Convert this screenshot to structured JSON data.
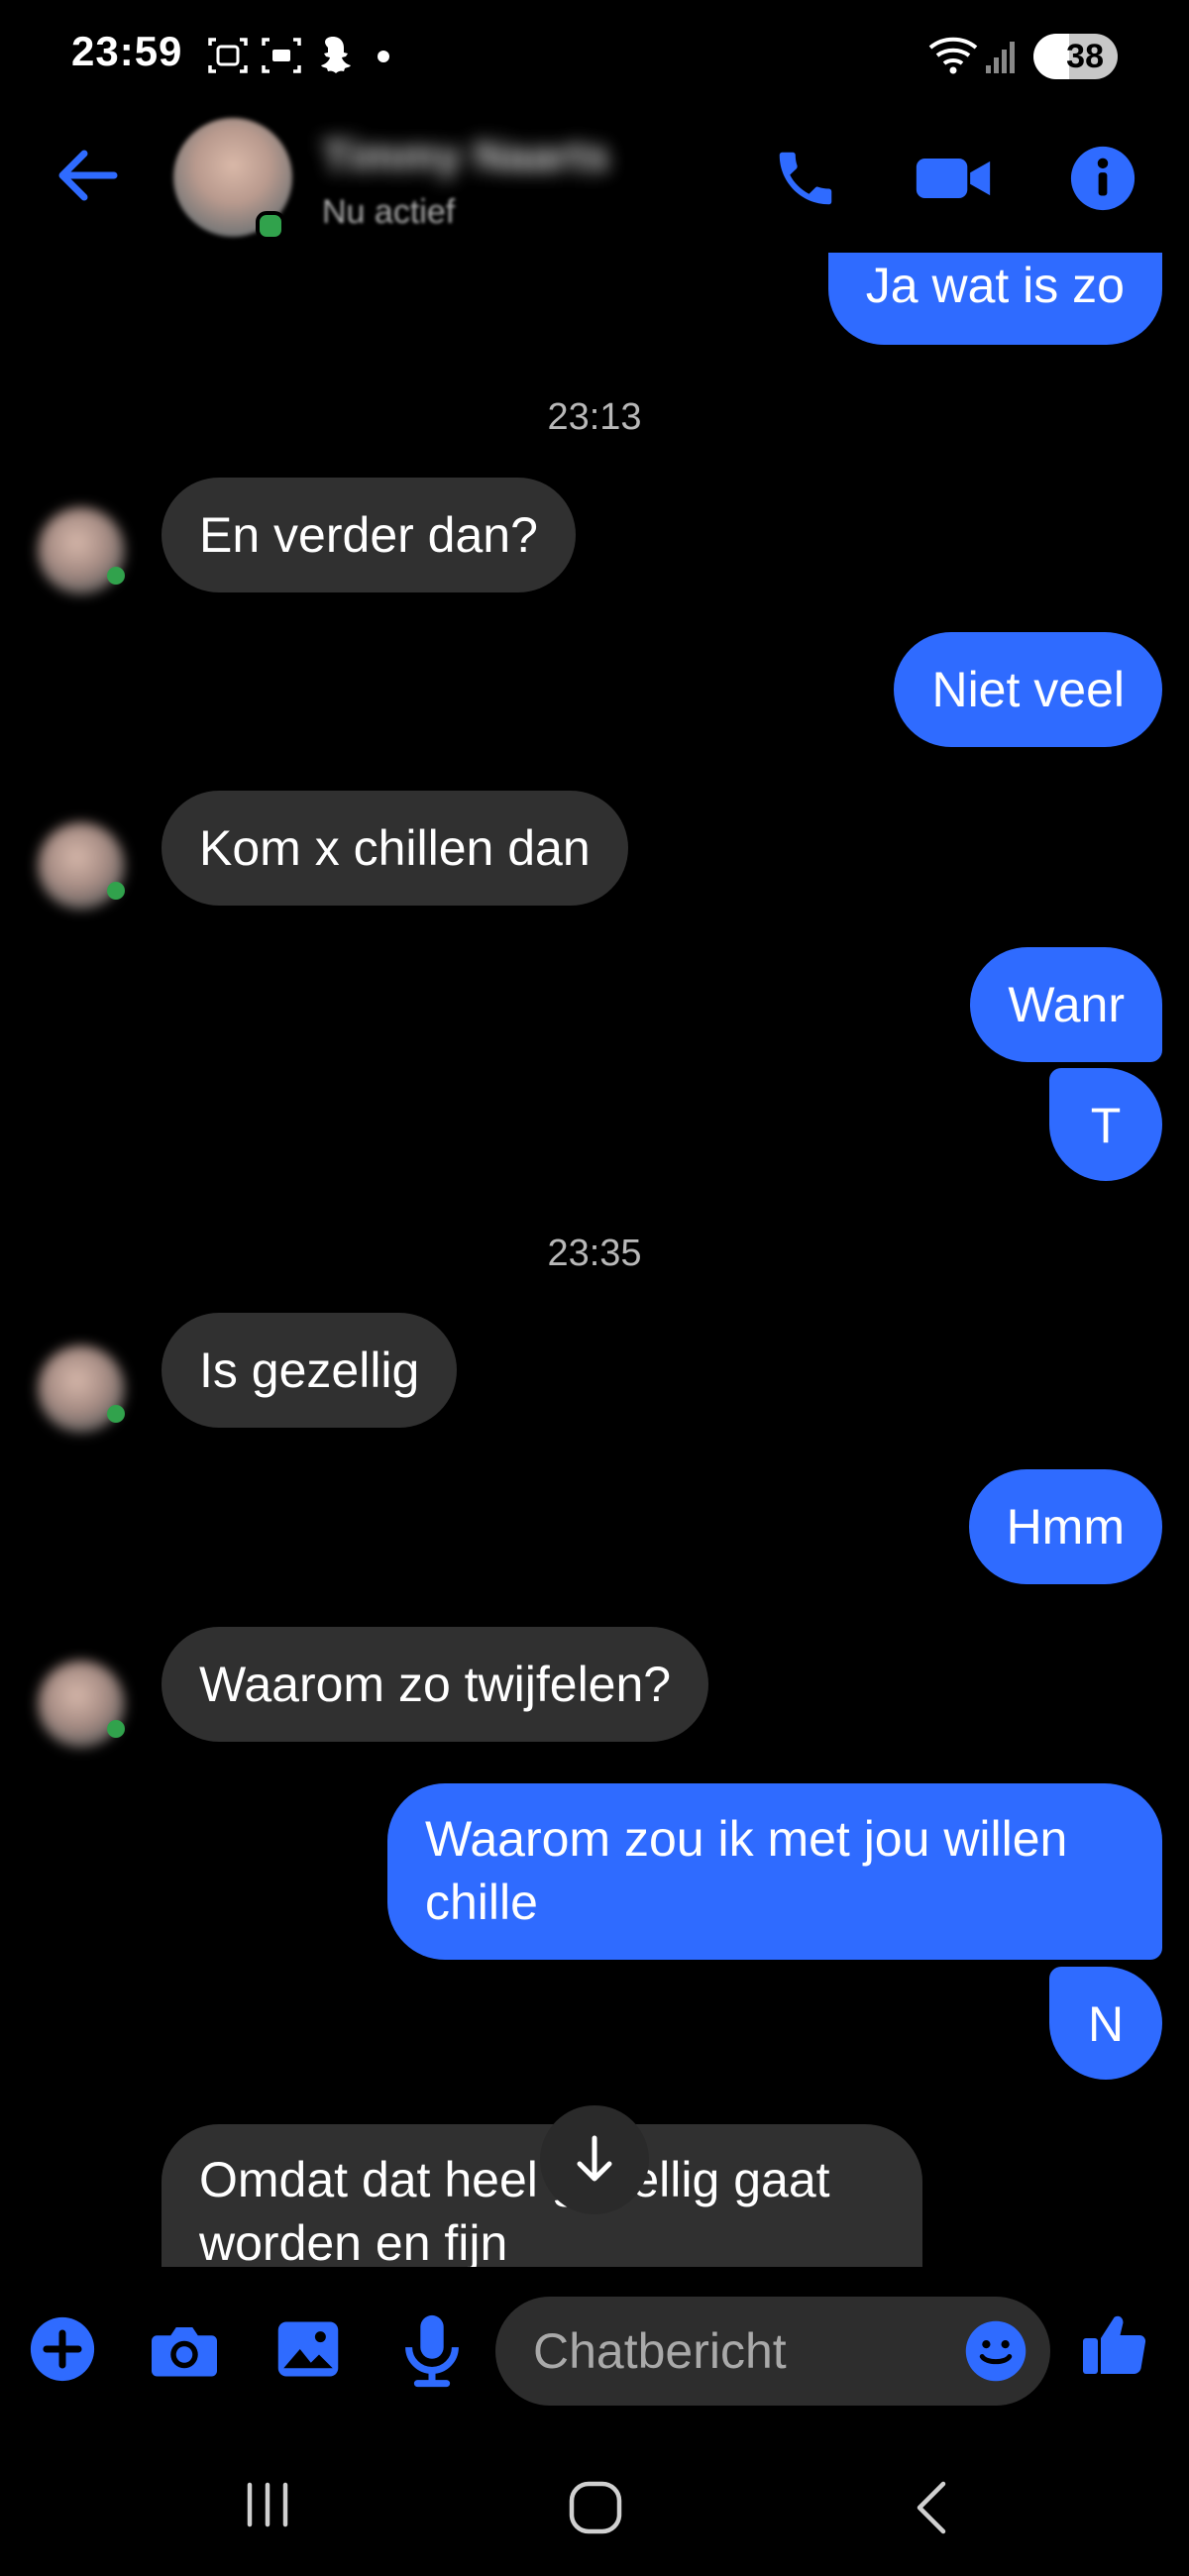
{
  "status_bar": {
    "time": "23:59",
    "battery": "38"
  },
  "header": {
    "contact_name": "Timmy Naarts",
    "contact_status": "Nu actief"
  },
  "messages": [
    {
      "from": "me",
      "text": "Ja wat is zo"
    },
    {
      "timestamp": "23:13"
    },
    {
      "from": "them",
      "text": "En verder dan?"
    },
    {
      "from": "me",
      "text": "Niet veel"
    },
    {
      "from": "them",
      "text": "Kom x chillen dan"
    },
    {
      "from": "me",
      "text": "Wanr"
    },
    {
      "from": "me",
      "text": "T"
    },
    {
      "timestamp": "23:35"
    },
    {
      "from": "them",
      "text": "Is gezellig"
    },
    {
      "from": "me",
      "text": "Hmm"
    },
    {
      "from": "them",
      "text": "Waarom zo twijfelen?"
    },
    {
      "from": "me",
      "text_line1": "Waarom zou ik met jou willen",
      "text_line2": "chille"
    },
    {
      "from": "me",
      "text": "N"
    },
    {
      "from": "them",
      "text_line1": "Omdat dat heel gezellig gaat",
      "text_line2": "worden en fijn"
    }
  ],
  "composer": {
    "placeholder": "Chatbericht"
  },
  "colors": {
    "accent": "#2f6bff",
    "incoming_bubble": "#303030",
    "background": "#000000",
    "online": "#31a24c"
  },
  "icons": [
    "back-arrow-icon",
    "phone-icon",
    "video-camera-icon",
    "info-icon",
    "plus-icon",
    "camera-icon",
    "gallery-icon",
    "microphone-icon",
    "emoji-icon",
    "thumbs-up-icon",
    "scroll-down-arrow-icon"
  ]
}
